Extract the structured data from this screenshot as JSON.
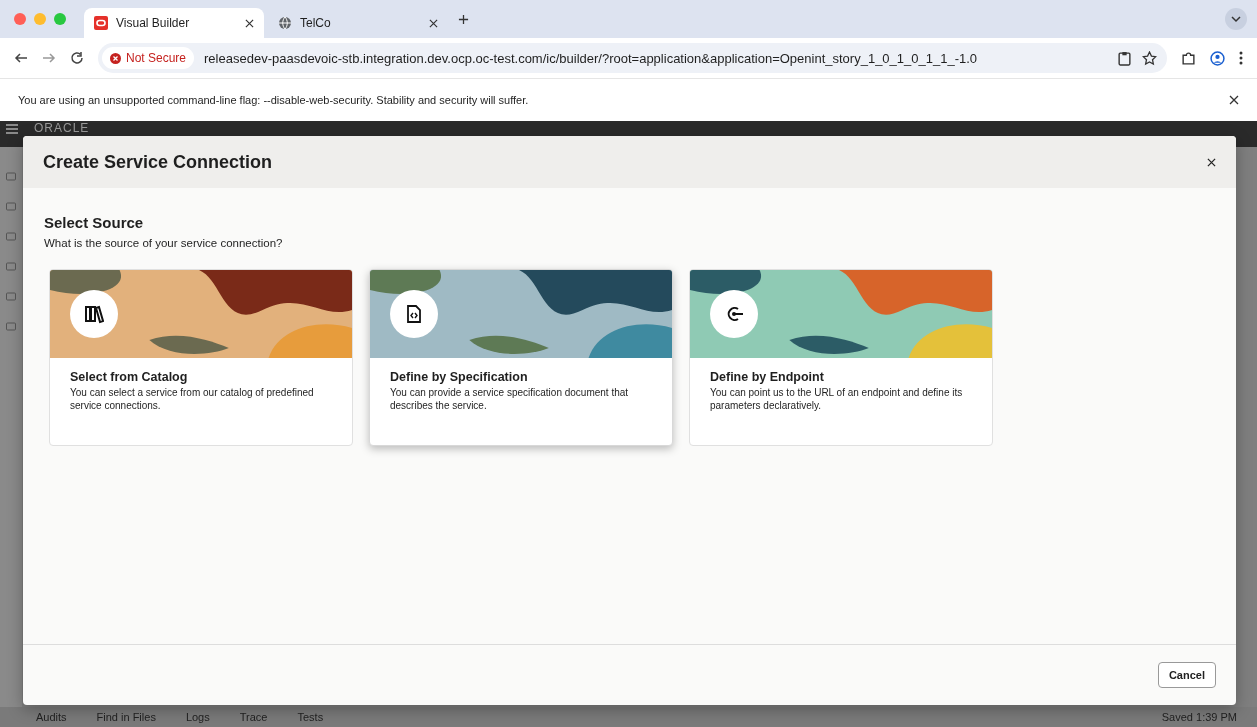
{
  "browser": {
    "tabs": [
      {
        "label": "Visual Builder",
        "selected": true
      },
      {
        "label": "TelCo",
        "selected": false
      }
    ],
    "url_badge": "Not Secure",
    "url": "releasedev-paasdevoic-stb.integration.dev.ocp.oc-test.com/ic/builder/?root=application&application=Openint_story_1_0_1_0_1_1_-1.0",
    "warning": "You are using an unsupported command-line flag: --disable-web-security. Stability and security will suffer."
  },
  "app": {
    "logo": "ORACLE",
    "footer_items": [
      "Audits",
      "Find in Files",
      "Logs",
      "Trace",
      "Tests"
    ],
    "status": "Saved 1:39 PM"
  },
  "dialog": {
    "title": "Create Service Connection",
    "heading": "Select Source",
    "subtitle": "What is the source of your service connection?",
    "cards": [
      {
        "kind": "catalog",
        "title": "Select from Catalog",
        "description": "You can select a service from our catalog of predefined service connections.",
        "selected": false
      },
      {
        "kind": "specification",
        "title": "Define by Specification",
        "description": "You can provide a service specification document that describes the service.",
        "selected": true
      },
      {
        "kind": "endpoint",
        "title": "Define by Endpoint",
        "description": "You can point us to the URL of an endpoint and define its parameters declaratively.",
        "selected": false
      }
    ],
    "buttons": [
      "Cancel"
    ]
  }
}
